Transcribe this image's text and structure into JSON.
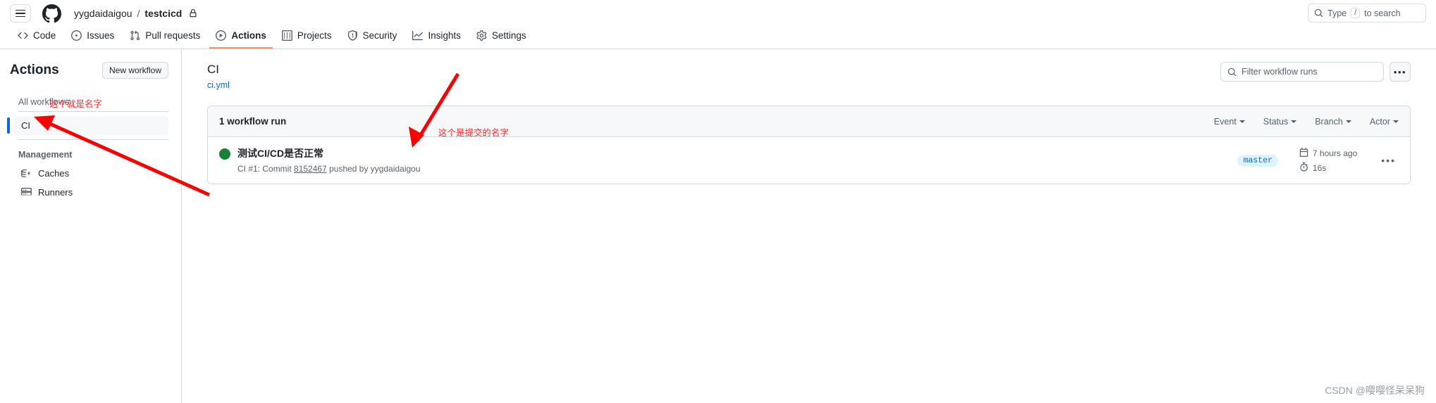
{
  "header": {
    "menu_icon": "hamburger-icon",
    "logo_icon": "github-logo-icon",
    "owner": "yygdaidaigou",
    "separator": "/",
    "repo": "testcicd",
    "lock_icon": "lock-icon",
    "search_placeholder_prefix": "Type",
    "search_key": "/",
    "search_placeholder_suffix": "to search"
  },
  "repo_nav": [
    {
      "label": "Code",
      "icon": "code-icon",
      "active": false
    },
    {
      "label": "Issues",
      "icon": "issue-opened-icon",
      "active": false
    },
    {
      "label": "Pull requests",
      "icon": "git-pull-request-icon",
      "active": false
    },
    {
      "label": "Actions",
      "icon": "play-icon",
      "active": true
    },
    {
      "label": "Projects",
      "icon": "table-icon",
      "active": false
    },
    {
      "label": "Security",
      "icon": "shield-icon",
      "active": false
    },
    {
      "label": "Insights",
      "icon": "graph-icon",
      "active": false
    },
    {
      "label": "Settings",
      "icon": "gear-icon",
      "active": false
    }
  ],
  "sidebar": {
    "title": "Actions",
    "new_workflow_label": "New workflow",
    "all_workflows_label": "All workflows",
    "workflows": [
      {
        "label": "CI",
        "selected": true
      }
    ],
    "management_label": "Management",
    "management_items": [
      {
        "label": "Caches",
        "icon": "cache-icon"
      },
      {
        "label": "Runners",
        "icon": "server-icon"
      }
    ]
  },
  "main": {
    "workflow_title": "CI",
    "workflow_file": "ci.yml",
    "filter_placeholder": "Filter workflow runs",
    "filter_icon": "search-icon",
    "kebab_label": "•••",
    "runs_count_label": "1 workflow run",
    "run_filters": [
      {
        "label": "Event"
      },
      {
        "label": "Status"
      },
      {
        "label": "Branch"
      },
      {
        "label": "Actor"
      }
    ],
    "runs": [
      {
        "status_icon": "check-circle-icon",
        "name": "测试CI/CD是否正常",
        "meta_prefix": "CI #1: Commit",
        "commit_sha": "8152467",
        "meta_suffix": "pushed by yygdaidaigou",
        "branch": "master",
        "time_icon": "calendar-icon",
        "time_ago": "7 hours ago",
        "duration_icon": "stopwatch-icon",
        "duration": "16s",
        "kebab_label": "•••"
      }
    ]
  },
  "annotations": [
    {
      "text": "这个就是名字",
      "color": "#ff2d2d"
    },
    {
      "text": "这个是提交的名字",
      "color": "#ff2d2d"
    }
  ],
  "watermark": "CSDN @嘤嘤怪呆呆狗",
  "colors": {
    "accent": "#0969da",
    "active_tab_underline": "#fd8c73",
    "success_green": "#1a7f37",
    "annotation_red": "#ff2d2d",
    "branch_badge_bg": "#ddf4ff"
  }
}
